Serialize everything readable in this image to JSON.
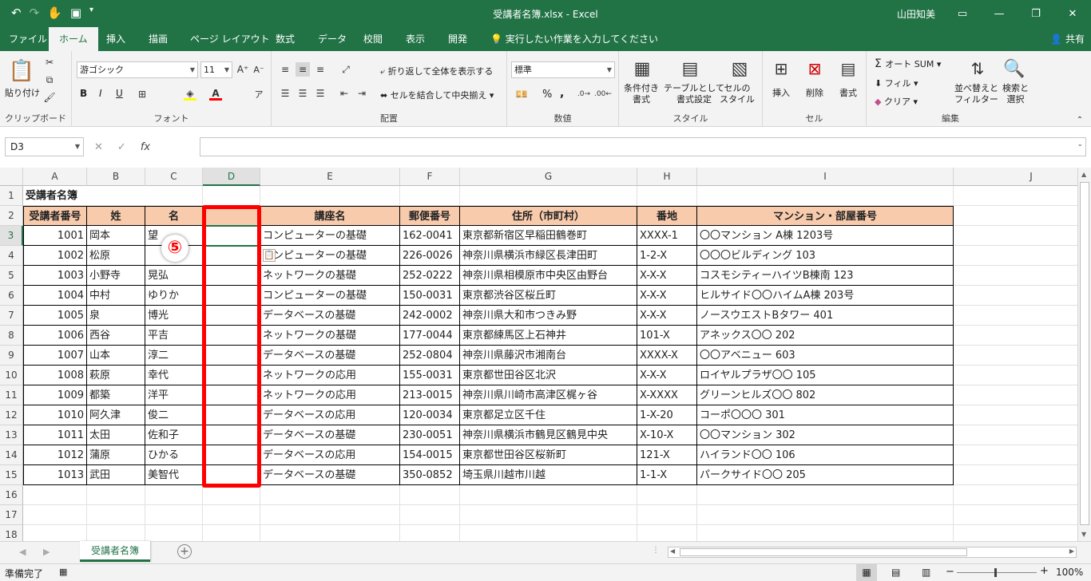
{
  "window": {
    "title": "受講者名簿.xlsx  -  Excel",
    "user": "山田知美"
  },
  "menu": {
    "tabs": [
      "ファイル",
      "ホーム",
      "挿入",
      "描画",
      "ページ レイアウト",
      "数式",
      "データ",
      "校閲",
      "表示",
      "開発"
    ],
    "tell_me": "実行したい作業を入力してください",
    "share": "共有"
  },
  "ribbon": {
    "clipboard": {
      "paste": "貼り付け",
      "label": "クリップボード"
    },
    "font": {
      "name": "游ゴシック",
      "size": "11",
      "bold": "B",
      "italic": "I",
      "underline": "U",
      "label": "フォント"
    },
    "alignment": {
      "wrap": "折り返して全体を表示する",
      "merge": "セルを結合して中央揃え",
      "label": "配置"
    },
    "number": {
      "format": "標準",
      "percent": "%",
      "comma": ",",
      "label": "数値"
    },
    "styles": {
      "conditional": "条件付き\n書式",
      "table": "テーブルとして\n書式設定",
      "cell": "セルの\nスタイル",
      "label": "スタイル"
    },
    "cells": {
      "insert": "挿入",
      "delete": "削除",
      "format": "書式",
      "label": "セル"
    },
    "editing": {
      "autosum": "オート SUM",
      "fill": "フィル",
      "clear": "クリア",
      "sort": "並べ替えと\nフィルター",
      "find": "検索と\n選択",
      "label": "編集"
    }
  },
  "formula_bar": {
    "name_box": "D3",
    "cancel": "✕",
    "enter": "✓",
    "fx": "fx",
    "value": ""
  },
  "columns": [
    "A",
    "B",
    "C",
    "D",
    "E",
    "F",
    "G",
    "H",
    "I",
    "J"
  ],
  "rows": [
    "1",
    "2",
    "3",
    "4",
    "5",
    "6",
    "7",
    "8",
    "9",
    "10",
    "11",
    "12",
    "13",
    "14",
    "15",
    "16",
    "17",
    "18"
  ],
  "sheet": {
    "title": "受講者名簿",
    "headers": [
      "受講者番号",
      "姓",
      "名",
      "",
      "講座名",
      "郵便番号",
      "住所（市町村）",
      "番地",
      "マンション・部屋番号"
    ],
    "data": [
      [
        "1001",
        "岡本",
        "望",
        "",
        "コンピューターの基礎",
        "162-0041",
        "東京都新宿区早稲田鶴巻町",
        "XXXX-1",
        "〇〇マンション A棟 1203号"
      ],
      [
        "1002",
        "松原",
        "",
        "",
        "コンピューターの基礎",
        "226-0026",
        "神奈川県横浜市緑区長津田町",
        "1-2-X",
        "〇〇〇ビルディング 103"
      ],
      [
        "1003",
        "小野寺",
        "晃弘",
        "",
        "ネットワークの基礎",
        "252-0222",
        "神奈川県相模原市中央区由野台",
        "X-X-X",
        "コスモシティーハイツB棟南 123"
      ],
      [
        "1004",
        "中村",
        "ゆりか",
        "",
        "コンピューターの基礎",
        "150-0031",
        "東京都渋谷区桜丘町",
        "X-X-X",
        "ヒルサイド〇〇ハイムA棟 203号"
      ],
      [
        "1005",
        "泉",
        "博光",
        "",
        "データベースの基礎",
        "242-0002",
        "神奈川県大和市つきみ野",
        "X-X-X",
        "ノースウエストBタワー 401"
      ],
      [
        "1006",
        "西谷",
        "平吉",
        "",
        "ネットワークの基礎",
        "177-0044",
        "東京都練馬区上石神井",
        "101-X",
        "アネックス〇〇 202"
      ],
      [
        "1007",
        "山本",
        "淳二",
        "",
        "データベースの基礎",
        "252-0804",
        "神奈川県藤沢市湘南台",
        "XXXX-X",
        "〇〇アベニュー 603"
      ],
      [
        "1008",
        "萩原",
        "幸代",
        "",
        "ネットワークの応用",
        "155-0031",
        "東京都世田谷区北沢",
        "X-X-X",
        "ロイヤルプラザ〇〇 105"
      ],
      [
        "1009",
        "都築",
        "洋平",
        "",
        "ネットワークの応用",
        "213-0015",
        "神奈川県川崎市高津区梶ヶ谷",
        "X-XXXX",
        "グリーンヒルズ〇〇 802"
      ],
      [
        "1010",
        "阿久津",
        "俊二",
        "",
        "データベースの応用",
        "120-0034",
        "東京都足立区千住",
        "1-X-20",
        "コーポ〇〇〇 301"
      ],
      [
        "1011",
        "太田",
        "佐和子",
        "",
        "データベースの基礎",
        "230-0051",
        "神奈川県横浜市鶴見区鶴見中央",
        "X-10-X",
        "〇〇マンション 302"
      ],
      [
        "1012",
        "蒲原",
        "ひかる",
        "",
        "データベースの応用",
        "154-0015",
        "東京都世田谷区桜新町",
        "121-X",
        "ハイランド〇〇 106"
      ],
      [
        "1013",
        "武田",
        "美智代",
        "",
        "データベースの基礎",
        "350-0852",
        "埼玉県川越市川越",
        "1-1-X",
        "パークサイド〇〇 205"
      ]
    ]
  },
  "annotation": {
    "step": "⑤",
    "color": "#ff0000"
  },
  "sheet_tab": "受講者名簿",
  "status": {
    "ready": "準備完了",
    "zoom": "100%"
  },
  "colors": {
    "accent": "#217346",
    "header_fill": "#f8cbad",
    "highlight": "#ff0000"
  }
}
